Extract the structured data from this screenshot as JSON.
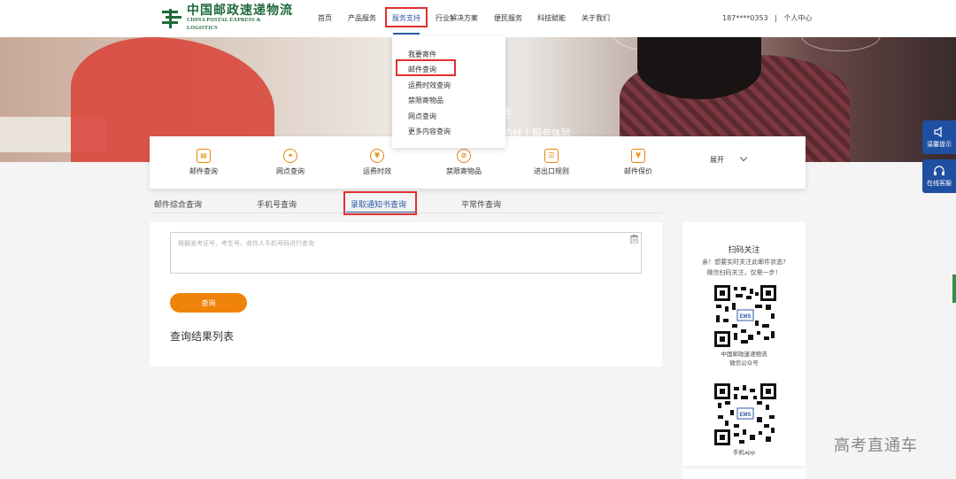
{
  "header": {
    "logo_cn": "中国邮政速递物流",
    "logo_en": "CHINA POSTAL EXPRESS & LOGISTICS",
    "nav": [
      "首页",
      "产品服务",
      "服务支持",
      "行业解决方案",
      "便民服务",
      "科技赋能",
      "关于我们"
    ],
    "active_nav": "服务支持",
    "user_phone": "187****0353",
    "separator": "|",
    "user_center": "个人中心"
  },
  "banner": {
    "title": "持",
    "subtitle": "的线上服务体验"
  },
  "dropdown": {
    "items": [
      "我要寄件",
      "邮件查询",
      "运费时效查询",
      "禁限寄物品",
      "网点查询",
      "更多内容查询"
    ],
    "highlighted": "邮件查询"
  },
  "services": {
    "items": [
      {
        "label": "邮件查询",
        "icon": "mail-search-icon",
        "glyph": "▤"
      },
      {
        "label": "网点查询",
        "icon": "location-icon",
        "glyph": "⌖"
      },
      {
        "label": "运费时效",
        "icon": "yuan-icon",
        "glyph": "¥"
      },
      {
        "label": "禁限寄物品",
        "icon": "forbidden-icon",
        "glyph": "⊘"
      },
      {
        "label": "进出口规则",
        "icon": "customs-icon",
        "glyph": "☰"
      },
      {
        "label": "邮件保价",
        "icon": "insurance-icon",
        "glyph": "¥"
      }
    ],
    "expand_label": "展开"
  },
  "tabs": {
    "items": [
      "邮件综合查询",
      "手机号查询",
      "录取通知书查询",
      "平常件查询"
    ],
    "active": "录取通知书查询"
  },
  "query": {
    "placeholder": "根据准考证号、考生号、收件人手机号码进行查询",
    "button_label": "查询",
    "results_title": "查询结果列表"
  },
  "qr_panel": {
    "title": "扫码关注",
    "desc_line1": "亲！想要实时关注此邮件状态?",
    "desc_line2": "微信扫码关注，仅需一步！",
    "qr1_caption_line1": "中国邮政速递物流",
    "qr1_caption_line2": "微信公众号",
    "qr2_caption": "手机app",
    "qr_badge": "EMS"
  },
  "float": {
    "tips_label": "温馨提示",
    "service_label": "在线客服"
  },
  "watermark": "高考直通车",
  "colors": {
    "accent_blue": "#2d5aa8",
    "accent_orange": "#f0830a",
    "highlight_red": "#e03030",
    "brand_green": "#1f6b3a",
    "float_blue": "#1f4fa0"
  }
}
